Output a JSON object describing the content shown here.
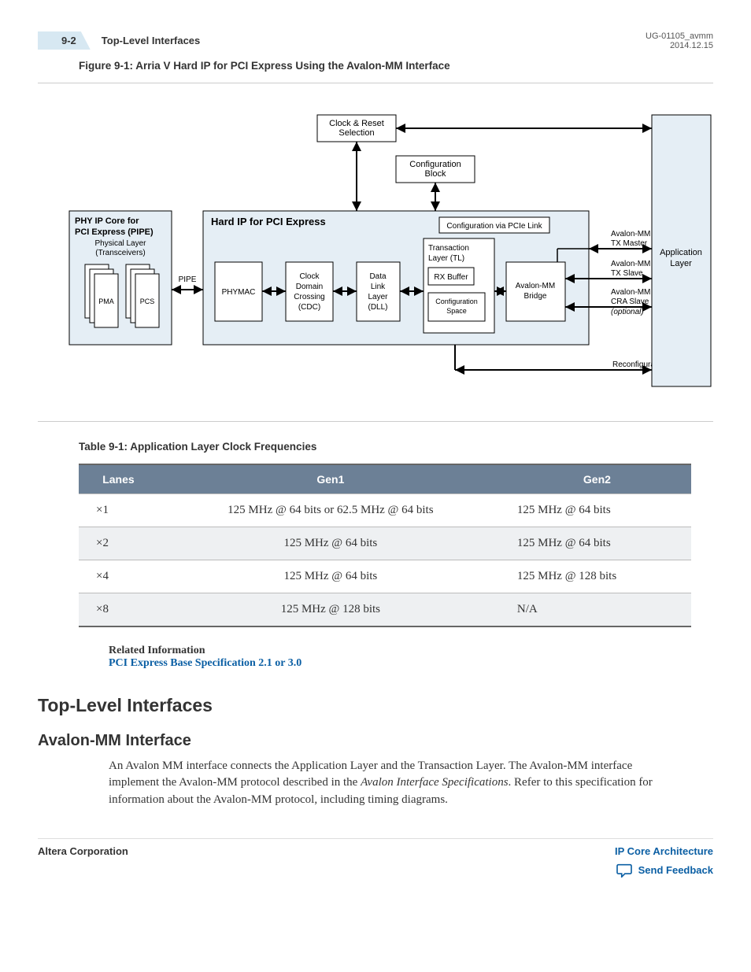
{
  "header": {
    "page_num": "9-2",
    "title": "Top-Level Interfaces",
    "doc_id": "UG-01105_avmm",
    "date": "2014.12.15"
  },
  "figure": {
    "caption": "Figure 9-1: Arria V Hard IP for PCI Express Using the Avalon-MM Interface",
    "blocks": {
      "clock_reset": "Clock & Reset Selection",
      "config_block": "Configuration Block",
      "phy_title": "PHY IP Core for PCI Express (PIPE)",
      "phy_sub1": "Physical Layer",
      "phy_sub2": "(Transceivers)",
      "pma": "PMA",
      "pcs": "PCS",
      "pipe": "PIPE",
      "hardip_title": "Hard IP  for PCI Express",
      "phymac": "PHYMAC",
      "cdc_l1": "Clock",
      "cdc_l2": "Domain",
      "cdc_l3": "Crossing",
      "cdc_l4": "(CDC)",
      "dll_l1": "Data",
      "dll_l2": "Link",
      "dll_l3": "Layer",
      "dll_l4": "(DLL)",
      "config_via": "Configuration via PCIe Link",
      "tl_l1": "Transaction",
      "tl_l2": "Layer (TL)",
      "rxbuf": "RX Buffer",
      "cfg_space_l1": "Configuration",
      "cfg_space_l2": "Space",
      "bridge_l1": "Avalon-MM",
      "bridge_l2": "Bridge",
      "txm_l1": "Avalon-MM",
      "txm_l2": "TX Master",
      "txs_l1": "Avalon-MM",
      "txs_l2": "TX Slave",
      "cra_l1": "Avalon-MM",
      "cra_l2": "CRA Slave",
      "cra_opt": "(optional)",
      "reconfig": "Reconfiguration",
      "app_l1": "Application",
      "app_l2": "Layer"
    }
  },
  "table": {
    "caption": "Table 9-1: Application Layer Clock Frequencies",
    "headers": [
      "Lanes",
      "Gen1",
      "Gen2"
    ],
    "rows": [
      [
        "×1",
        "125 MHz @ 64 bits or 62.5 MHz @ 64 bits",
        "125 MHz @ 64 bits"
      ],
      [
        "×2",
        "125 MHz @ 64 bits",
        "125 MHz @ 64 bits"
      ],
      [
        "×4",
        "125 MHz @ 64 bits",
        "125 MHz @ 128 bits"
      ],
      [
        "×8",
        "125 MHz @ 128 bits",
        "N/A"
      ]
    ]
  },
  "related": {
    "label": "Related Information",
    "link": "PCI Express Base Specification 2.1 or 3.0"
  },
  "sections": {
    "h2": "Top-Level Interfaces",
    "h3": "Avalon-MM Interface",
    "body_pre": "An Avalon MM interface connects the Application Layer and the Transaction Layer. The Avalon-MM interface implement the Avalon-MM protocol described in the ",
    "body_em": "Avalon Interface Specifications",
    "body_post": ". Refer to this specification for information about the Avalon-MM protocol, including timing diagrams."
  },
  "footer": {
    "left": "Altera Corporation",
    "link1": "IP Core Architecture",
    "feedback": "Send Feedback"
  }
}
